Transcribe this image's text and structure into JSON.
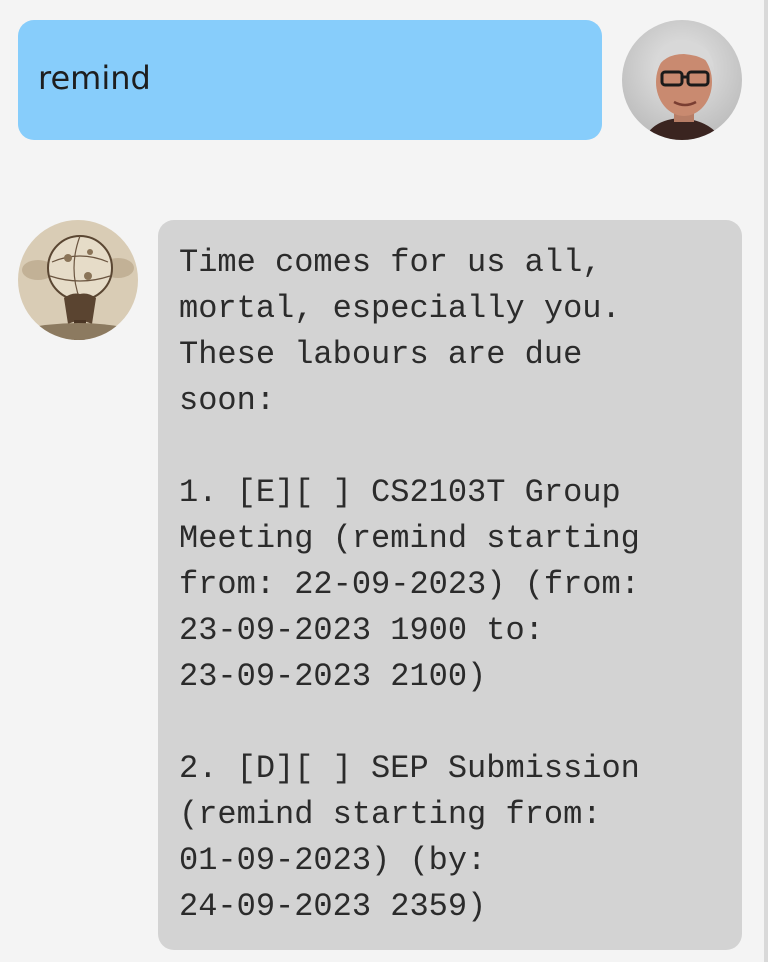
{
  "user_message": {
    "text": "remind",
    "avatar_icon": "user-portrait-icon"
  },
  "bot_message": {
    "text": "Time comes for us all,\nmortal, especially you.\nThese labours are due\nsoon:\n\n1. [E][ ] CS2103T Group\nMeeting (remind starting\nfrom: 22-09-2023) (from:\n23-09-2023 1900 to:\n23-09-2023 2100)\n\n2. [D][ ] SEP Submission\n(remind starting from:\n01-09-2023) (by:\n24-09-2023 2359)",
    "avatar_icon": "atlas-engraving-icon"
  },
  "colors": {
    "background": "#f4f4f4",
    "user_bubble": "#87cdfb",
    "bot_bubble": "#d3d3d3"
  }
}
